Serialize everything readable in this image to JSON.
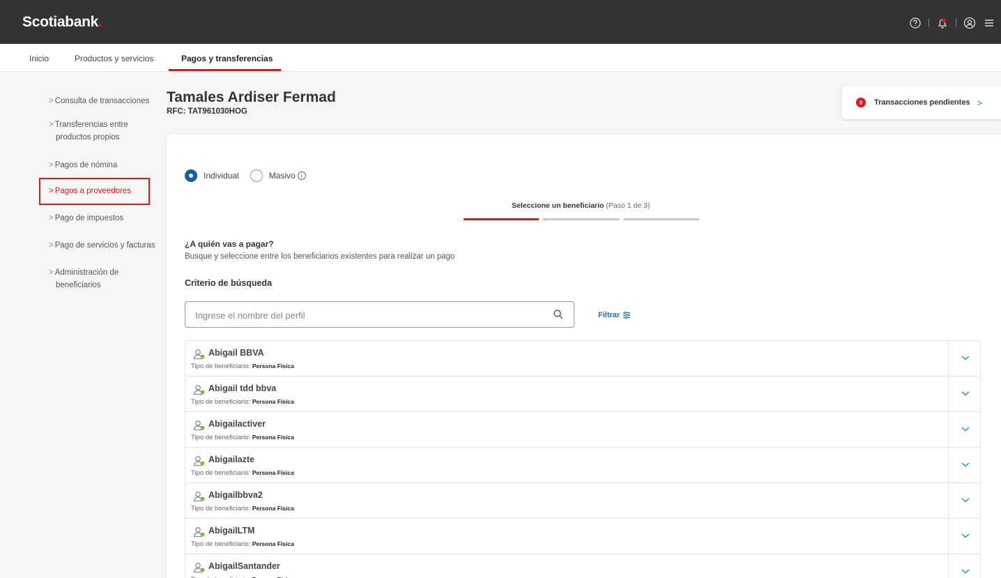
{
  "brand": {
    "name": "Scotiabank",
    "dot": "."
  },
  "top_icons": [
    "help-icon",
    "notification-bell-icon",
    "user-account-icon",
    "menu-icon"
  ],
  "nav": [
    {
      "label": "Inicio"
    },
    {
      "label": "Productos y servicios"
    },
    {
      "label": "Pagos y transferencias",
      "active": true
    }
  ],
  "sidebar": [
    {
      "label": "Consulta de transacciones"
    },
    {
      "label": "Transferencias entre",
      "label2": "productos propios"
    },
    {
      "label": "Pagos de nómina"
    },
    {
      "label": "Pagos a proveedores",
      "active": true
    },
    {
      "label": "Pago de impuestos"
    },
    {
      "label": "Pago de servicios y facturas"
    },
    {
      "label": "Administración de",
      "label2": "beneficiarios"
    }
  ],
  "header": {
    "company": "Tamales Ardiser Fermad",
    "rfc": "RFC: TAT961030HOG"
  },
  "pending": {
    "count": "0",
    "label": "Transacciones pendientes"
  },
  "payment_mode": {
    "individual": "Individual",
    "masivo": "Masivo",
    "selected": "individual"
  },
  "stepper": {
    "title": "Seleccione un beneficiario",
    "step": "(Paso 1 de 3)",
    "progress": 1,
    "total": 3
  },
  "question": {
    "title": "¿A quién vas a pagar?",
    "subtitle": "Busque y seleccione entre los beneficiarios existentes para realizar un pago"
  },
  "criteria_title": "Criterio de búsqueda",
  "search": {
    "placeholder": "Ingrese el nombre del perfil",
    "value": ""
  },
  "filter_label": "Filtrar",
  "type_label": "Tipo de beneficiario: ",
  "beneficiaries": [
    {
      "name": "Abigail BBVA",
      "type": "Persona Física"
    },
    {
      "name": "Abigail tdd bbva",
      "type": "Persona Física"
    },
    {
      "name": "Abigailactiver",
      "type": "Persona Física"
    },
    {
      "name": "Abigailazte",
      "type": "Persona Física"
    },
    {
      "name": "Abigailbbva2",
      "type": "Persona Física"
    },
    {
      "name": "AbigailLTM",
      "type": "Persona Física"
    },
    {
      "name": "AbigailSantander",
      "type": "Persona Física"
    }
  ],
  "colors": {
    "brand_red": "#ec111a",
    "topbar": "#333333",
    "link_blue": "#1f6fbf",
    "radio_blue": "#1a5ba8"
  }
}
